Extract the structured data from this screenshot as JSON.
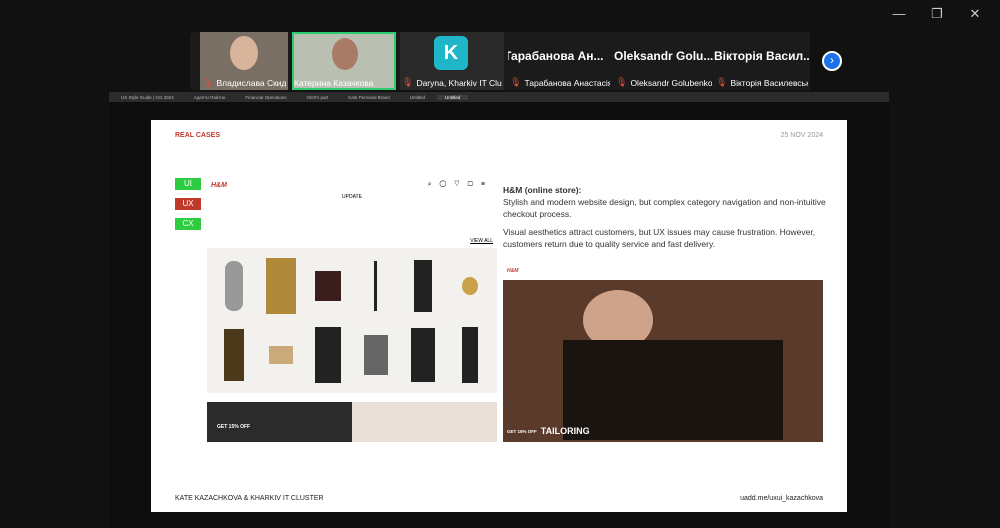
{
  "participants": [
    {
      "name": "Владислава Скидан",
      "muted": true
    },
    {
      "name": "Катерина Казачкова",
      "muted": false,
      "active": true
    },
    {
      "name": "Daryna, Kharkiv IT Clus...",
      "muted": true,
      "logo": true
    },
    {
      "name": "Тарабанова Анастасія",
      "muted": true,
      "bigname": "Тарабанова Ан..."
    },
    {
      "name": "Oleksandr Golubenko",
      "muted": true,
      "bigname": "Oleksandr Golu..."
    },
    {
      "name": "Вікторія Василевська",
      "muted": true,
      "bigname": "Вікторія Васил..."
    }
  ],
  "browser_tabs": [
    "UX Style Guide | Oct 2024",
    "Адепти Пайтон",
    "Financial Operations",
    "Oleh's part",
    "Kate Personal Brand",
    "Untitled",
    "Untitled"
  ],
  "slide": {
    "section": "REAL CASES",
    "date": "25 NOV 2024",
    "tags": [
      {
        "label": "UI",
        "color": "#2ecc40"
      },
      {
        "label": "UX",
        "color": "#c0392b"
      },
      {
        "label": "CX",
        "color": "#2ecc40"
      }
    ],
    "site_logo": "H&M",
    "site_update": "UPDATE",
    "view_all": "VIEW ALL",
    "promo": "GET 15% OFF",
    "promo2": "GET 15% OFF",
    "tailoring": "TAILORING",
    "heading": "H&M (online store):",
    "p1": "Stylish and modern website design, but complex category navigation and non-intuitive checkout process.",
    "p2": "Visual aesthetics attract customers, but UX issues may cause frustration. However, customers return due to quality service and fast delivery.",
    "author": "KATE KAZACHKOVA & KHARKIV IT CLUSTER",
    "link": "uadd.me/uxui_kazachkova"
  },
  "colors": {
    "accent": "#c0392b",
    "active": "#2ecc71"
  }
}
